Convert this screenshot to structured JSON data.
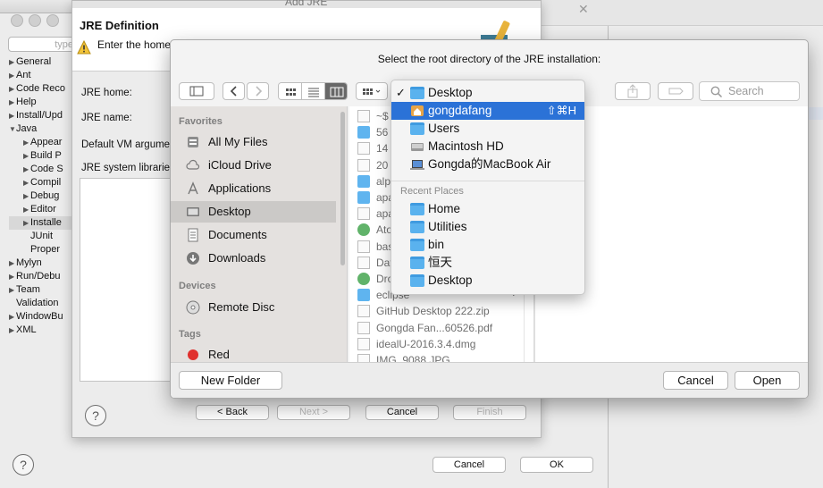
{
  "prefs": {
    "filter_placeholder": "type",
    "tree": [
      {
        "label": "General",
        "indent": 0,
        "tw": "▶"
      },
      {
        "label": "Ant",
        "indent": 0,
        "tw": "▶"
      },
      {
        "label": "Code Reco",
        "indent": 0,
        "tw": "▶"
      },
      {
        "label": "Help",
        "indent": 0,
        "tw": "▶"
      },
      {
        "label": "Install/Upd",
        "indent": 0,
        "tw": "▶"
      },
      {
        "label": "Java",
        "indent": 0,
        "tw": "▼"
      },
      {
        "label": "Appear",
        "indent": 1,
        "tw": "▶"
      },
      {
        "label": "Build P",
        "indent": 1,
        "tw": "▶"
      },
      {
        "label": "Code S",
        "indent": 1,
        "tw": "▶"
      },
      {
        "label": "Compil",
        "indent": 1,
        "tw": "▶"
      },
      {
        "label": "Debug",
        "indent": 1,
        "tw": "▶"
      },
      {
        "label": "Editor",
        "indent": 1,
        "tw": "▶"
      },
      {
        "label": "Installe",
        "indent": 1,
        "tw": "▶",
        "selected": true
      },
      {
        "label": "JUnit",
        "indent": 1,
        "tw": ""
      },
      {
        "label": "Proper",
        "indent": 1,
        "tw": ""
      },
      {
        "label": "Mylyn",
        "indent": 0,
        "tw": "▶"
      },
      {
        "label": "Run/Debu",
        "indent": 0,
        "tw": "▶"
      },
      {
        "label": "Team",
        "indent": 0,
        "tw": "▶"
      },
      {
        "label": "Validation",
        "indent": 0,
        "tw": ""
      },
      {
        "label": "WindowBu",
        "indent": 0,
        "tw": "▶"
      },
      {
        "label": "XML",
        "indent": 0,
        "tw": "▶"
      }
    ],
    "help_label": "?",
    "cancel_label": "Cancel",
    "ok_label": "OK"
  },
  "addjre": {
    "window_title": "Add JRE",
    "section_title": "JRE Definition",
    "message": "Enter the home",
    "labels": {
      "home": "JRE home:",
      "name": "JRE name:",
      "vm_args": "Default VM argume",
      "libraries": "JRE system librarie"
    },
    "help_label": "?",
    "back_label": "< Back",
    "next_label": "Next >",
    "cancel_label": "Cancel",
    "finish_label": "Finish"
  },
  "chooser": {
    "title": "Select the root directory of the JRE installation:",
    "search_placeholder": "Search",
    "sidebar": {
      "favorites_heading": "Favorites",
      "favorites": [
        {
          "label": "All My Files",
          "icon": "all-files-icon"
        },
        {
          "label": "iCloud Drive",
          "icon": "cloud-icon"
        },
        {
          "label": "Applications",
          "icon": "applications-icon"
        },
        {
          "label": "Desktop",
          "icon": "desktop-icon",
          "selected": true
        },
        {
          "label": "Documents",
          "icon": "documents-icon"
        },
        {
          "label": "Downloads",
          "icon": "downloads-icon"
        }
      ],
      "devices_heading": "Devices",
      "devices": [
        {
          "label": "Remote Disc",
          "icon": "disc-icon"
        }
      ],
      "tags_heading": "Tags",
      "tags": [
        {
          "label": "Red",
          "color": "#e0312e"
        }
      ]
    },
    "files": [
      {
        "name": "~$",
        "kind": "doc"
      },
      {
        "name": "56",
        "kind": "folder"
      },
      {
        "name": "14",
        "kind": "doc"
      },
      {
        "name": "20",
        "kind": "doc"
      },
      {
        "name": "alp",
        "kind": "folder"
      },
      {
        "name": "apa",
        "kind": "folder"
      },
      {
        "name": "apa",
        "kind": "doc"
      },
      {
        "name": "Ato",
        "kind": "app"
      },
      {
        "name": "bas",
        "kind": "doc"
      },
      {
        "name": "Dat",
        "kind": "doc"
      },
      {
        "name": "Dro",
        "kind": "app"
      },
      {
        "name": "eclipse",
        "kind": "folder"
      },
      {
        "name": "GitHub Desktop 222.zip",
        "kind": "doc"
      },
      {
        "name": "Gongda Fan...60526.pdf",
        "kind": "doc"
      },
      {
        "name": "idealU-2016.3.4.dmg",
        "kind": "doc"
      },
      {
        "name": "IMG_9088.JPG",
        "kind": "doc"
      }
    ],
    "new_folder_label": "New Folder",
    "cancel_label": "Cancel",
    "open_label": "Open"
  },
  "menu": {
    "items": [
      {
        "label": "Desktop",
        "icon": "folder-icon",
        "checked": true
      },
      {
        "label": "gongdafang",
        "icon": "home-icon",
        "highlighted": true,
        "shortcut": "⇧⌘H"
      },
      {
        "label": "Users",
        "icon": "folder-icon"
      },
      {
        "label": "Macintosh HD",
        "icon": "hard-drive-icon"
      },
      {
        "label": "Gongda的MacBook Air",
        "icon": "laptop-icon"
      }
    ],
    "recent_heading": "Recent Places",
    "recent": [
      {
        "label": "Home",
        "icon": "folder-icon"
      },
      {
        "label": "Utilities",
        "icon": "folder-icon"
      },
      {
        "label": "bin",
        "icon": "folder-icon"
      },
      {
        "label": "恒天",
        "icon": "folder-icon"
      },
      {
        "label": "Desktop",
        "icon": "folder-icon"
      }
    ],
    "checkmark": "✓"
  }
}
